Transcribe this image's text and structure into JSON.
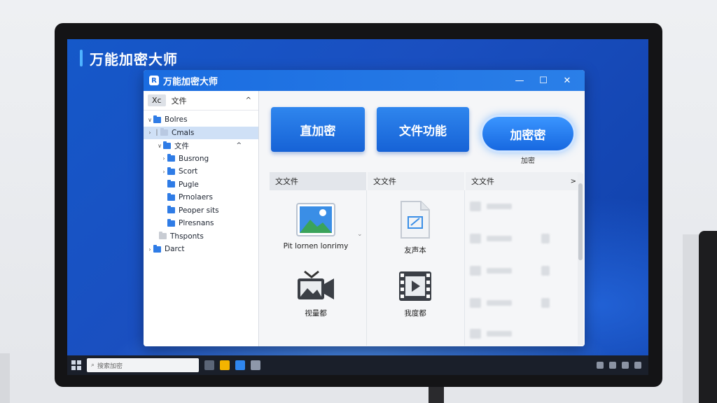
{
  "desktop": {
    "title": "万能加密大师"
  },
  "window": {
    "title": "万能加密大师",
    "icon_letter": "R",
    "controls": {
      "minimize": "—",
      "maximize": "☐",
      "close": "✕"
    }
  },
  "sidebar": {
    "header_pill": "Xc",
    "header_label": "文件",
    "header_chevron": "^",
    "items": [
      {
        "label": "Bolres"
      },
      {
        "label": "Cmals"
      },
      {
        "label": "文件"
      },
      {
        "label": "Busrong"
      },
      {
        "label": "Scort"
      },
      {
        "label": "Pugle"
      },
      {
        "label": "Prnolaers"
      },
      {
        "label": "Peoper sits"
      },
      {
        "label": "Plresnans"
      },
      {
        "label": "Thsponts"
      },
      {
        "label": "Darct"
      }
    ]
  },
  "actions": {
    "btn1": "直加密",
    "btn2": "文件功能",
    "btn3": "加密密",
    "btn3_caption": "加密"
  },
  "grid": {
    "headers": [
      "文文件",
      "文文件",
      "文文件"
    ],
    "more": ">",
    "items": [
      {
        "label": "Pit lornen lonrimy",
        "icon": "image-icon"
      },
      {
        "label": "友声本",
        "icon": "document-edit-icon"
      },
      {
        "label": "视量都",
        "icon": "video-camera-icon"
      },
      {
        "label": "我度都",
        "icon": "video-play-icon"
      }
    ]
  },
  "taskbar": {
    "search_placeholder": "搜索加密"
  }
}
